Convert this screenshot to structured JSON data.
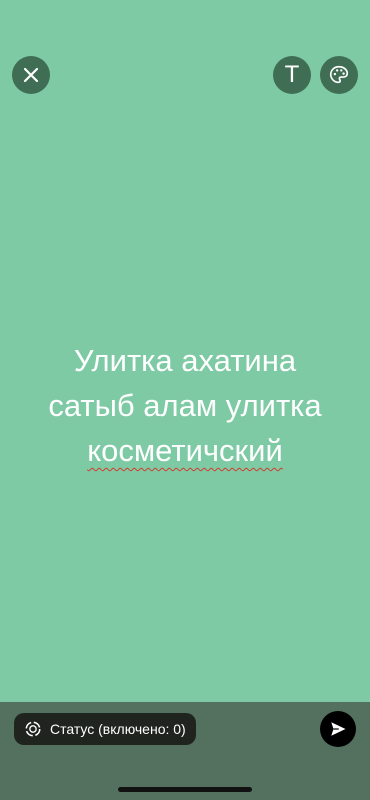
{
  "top_bar": {
    "text_button_label": "T"
  },
  "status_text": {
    "lines": [
      "Улитка ахатина",
      "сатыб алам улитка",
      "косметичский"
    ]
  },
  "bottom_bar": {
    "status_label": "Статус (включено: 0)"
  },
  "colors": {
    "background": "#7ecaa4",
    "button_bg": "#3f6e55",
    "bottom_bar": "#53715e"
  },
  "icons": [
    "close-icon",
    "text-icon",
    "palette-icon",
    "status-ring-icon",
    "send-icon"
  ]
}
